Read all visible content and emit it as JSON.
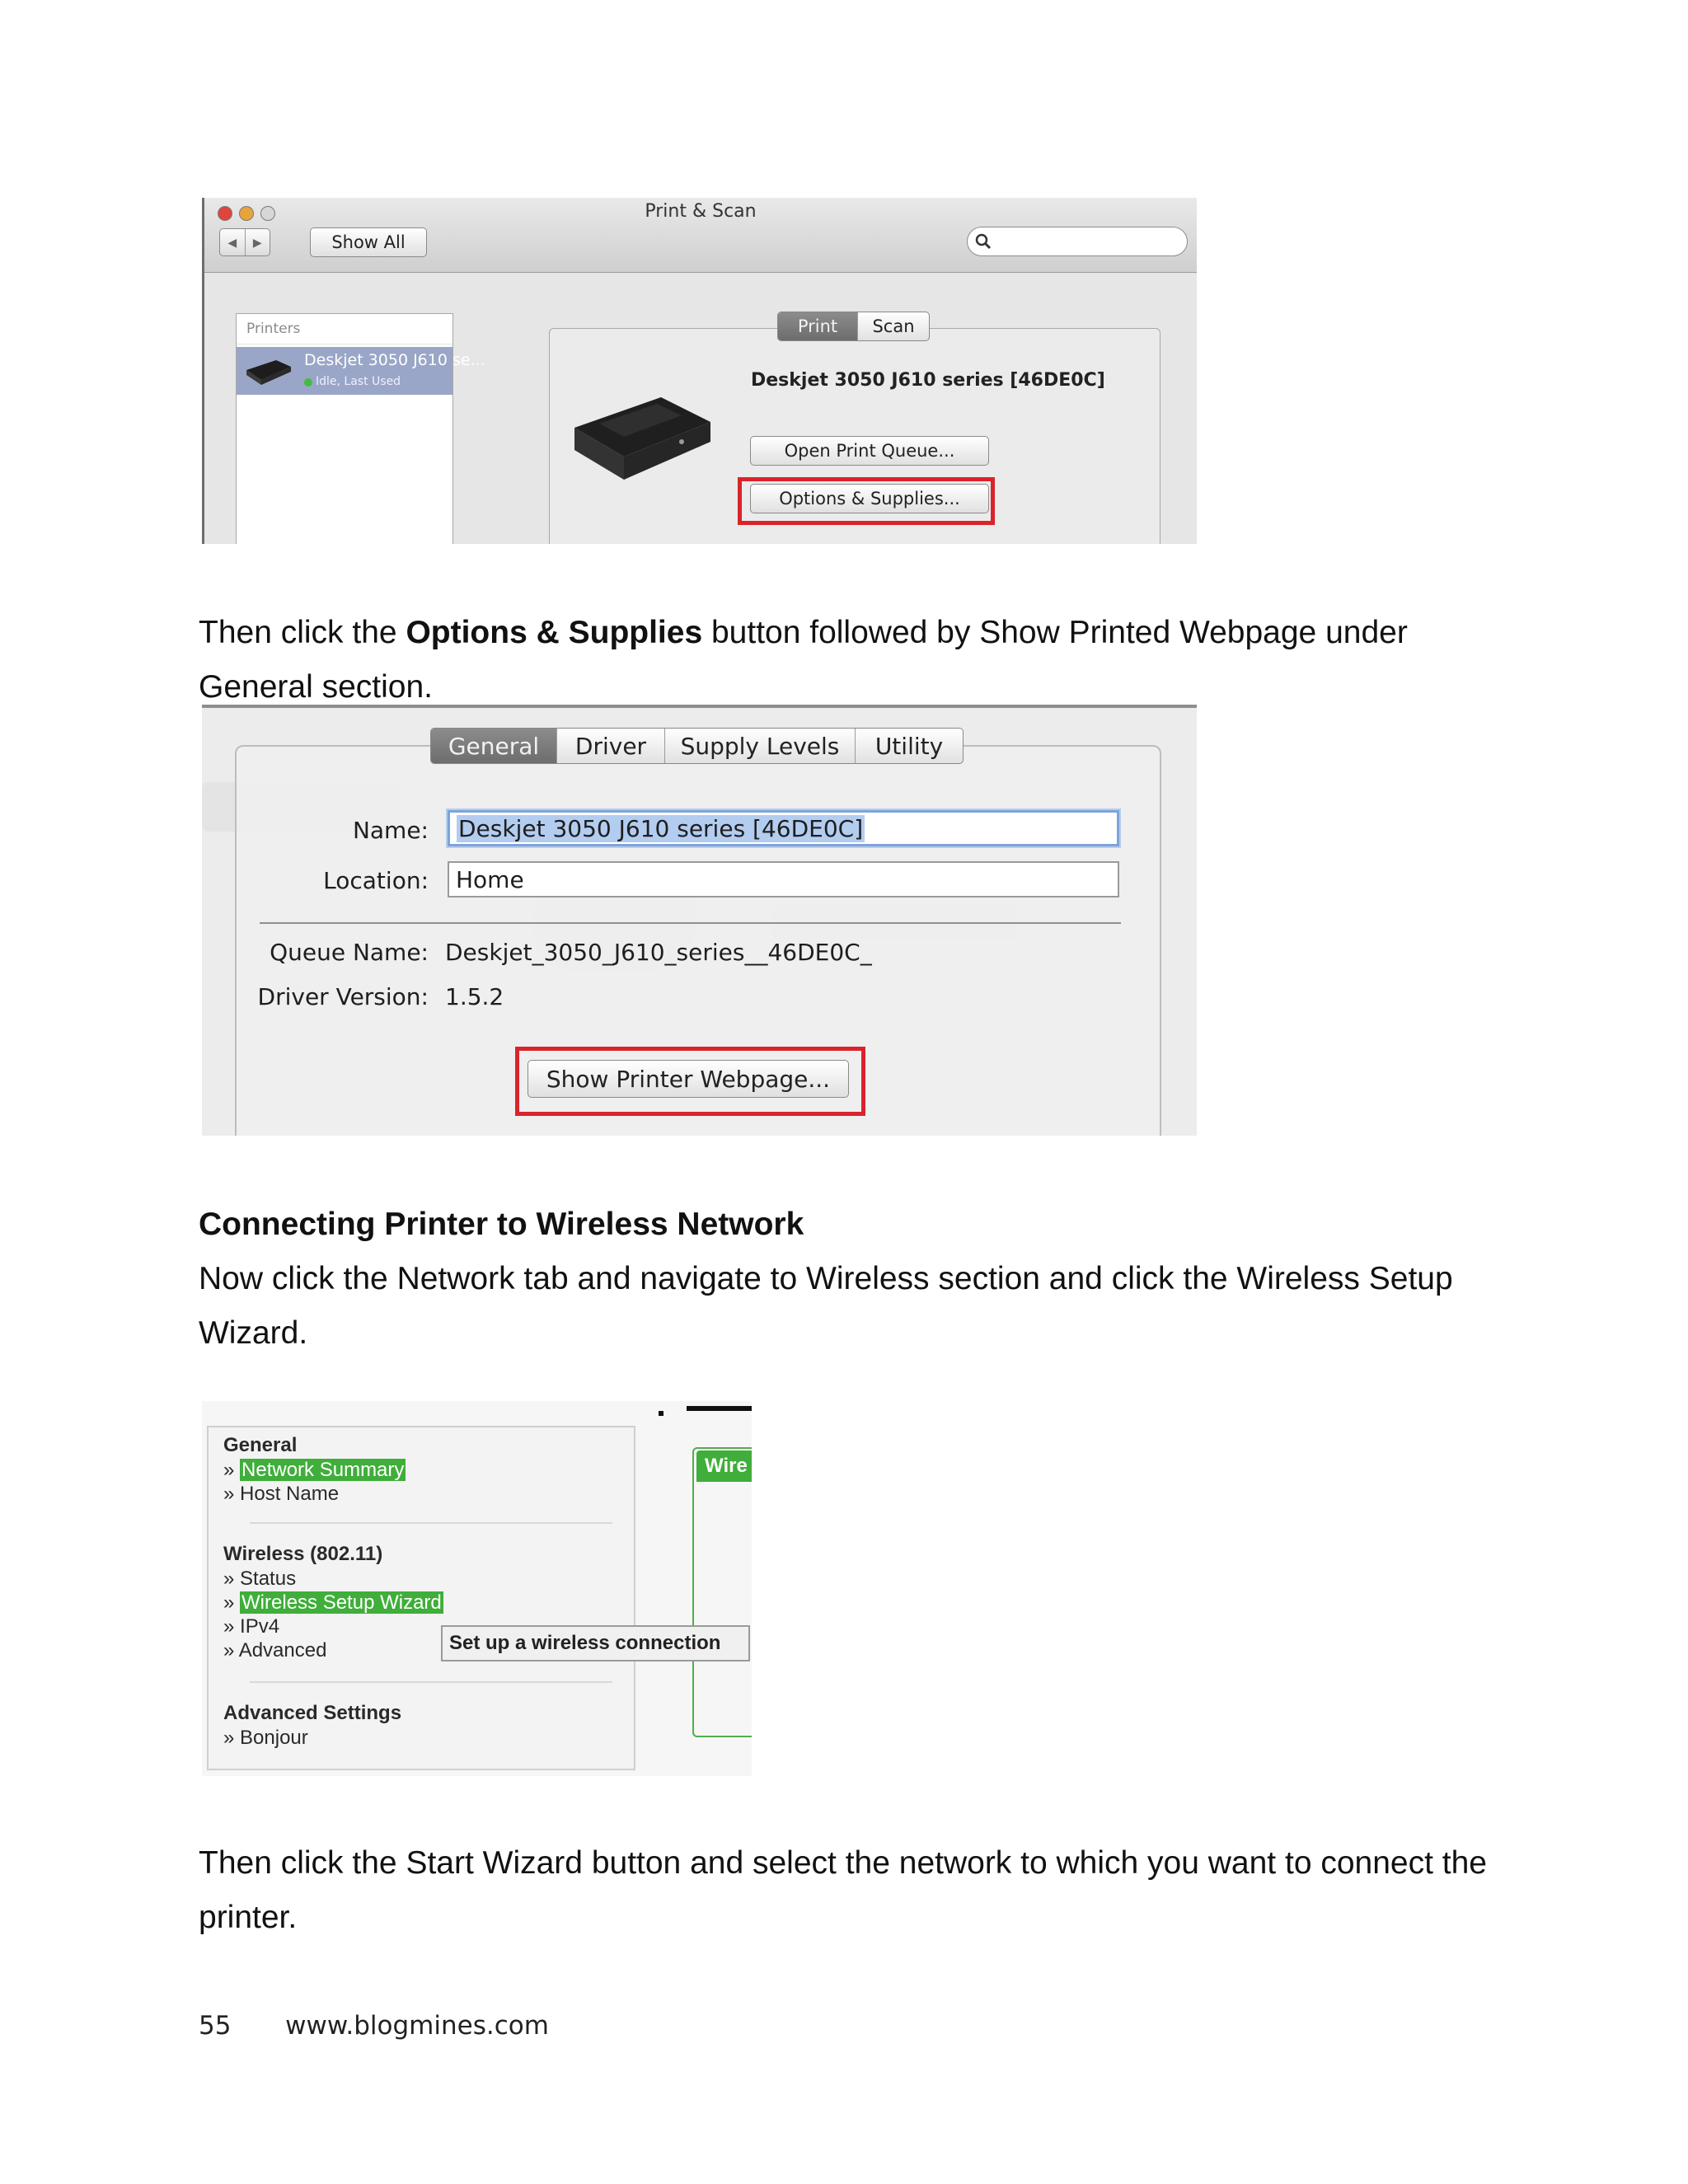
{
  "screenshot1": {
    "window_title": "Print & Scan",
    "show_all": "Show All",
    "printers_header": "Printers",
    "printer_name": "Deskjet 3050 J610 se...",
    "printer_status": "Idle, Last Used",
    "tab_print": "Print",
    "tab_scan": "Scan",
    "device_title": "Deskjet 3050 J610 series [46DE0C]",
    "open_print_queue": "Open Print Queue...",
    "options_supplies": "Options & Supplies..."
  },
  "para1": {
    "before": "Then click the ",
    "bold": "Options & Supplies",
    "after": " button followed by Show Printed Webpage under General section."
  },
  "screenshot2": {
    "tabs": [
      "General",
      "Driver",
      "Supply Levels",
      "Utility"
    ],
    "name_label": "Name:",
    "name_value": "Deskjet 3050 J610 series [46DE0C]",
    "location_label": "Location:",
    "location_value": "Home",
    "queue_label": "Queue Name:",
    "queue_value": "Deskjet_3050_J610_series__46DE0C_",
    "driver_label": "Driver Version:",
    "driver_value": "1.5.2",
    "show_webpage": "Show Printer Webpage..."
  },
  "heading": "Connecting Printer to Wireless Network",
  "para2": "Now click the Network tab and navigate to Wireless section and click the Wireless Setup Wizard.",
  "screenshot3": {
    "general_head": "General",
    "network_summary": "Network Summary",
    "host_name": "Host Name",
    "wireless_head": "Wireless (802.11)",
    "status": "Status",
    "wireless_setup_wizard": "Wireless Setup Wizard",
    "ipv4": "IPv4",
    "advanced": "Advanced",
    "advanced_settings_head": "Advanced Settings",
    "bonjour": "Bonjour",
    "tooltip": "Set up a wireless connection",
    "wire_tab": "Wire",
    "bullet": "»"
  },
  "para3": "Then click the Start Wizard button and select the network to which you want to connect the printer.",
  "footer": {
    "page_number": "55",
    "site": "www.blogmines.com"
  },
  "colors": {
    "highlight_red": "#d9242b",
    "highlight_green": "#3fae3a",
    "focus_blue": "#7ea3da"
  }
}
